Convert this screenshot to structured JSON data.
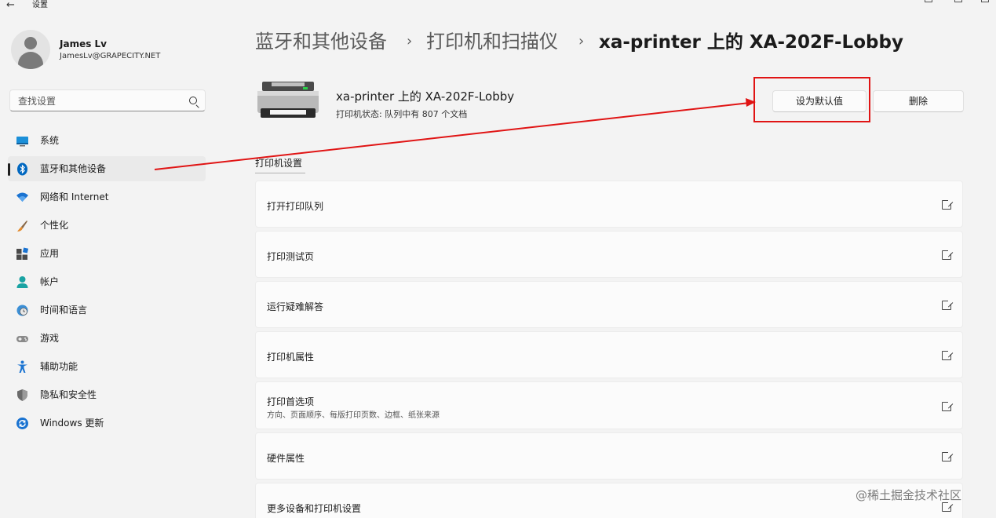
{
  "window": {
    "title": "设置"
  },
  "user": {
    "name": "James Lv",
    "email": "JamesLv@GRAPECITY.NET"
  },
  "search": {
    "placeholder": "查找设置"
  },
  "nav": [
    {
      "label": "系统",
      "icon": "monitor-icon"
    },
    {
      "label": "蓝牙和其他设备",
      "icon": "bluetooth-icon",
      "active": true
    },
    {
      "label": "网络和 Internet",
      "icon": "wifi-icon"
    },
    {
      "label": "个性化",
      "icon": "brush-icon"
    },
    {
      "label": "应用",
      "icon": "apps-icon"
    },
    {
      "label": "帐户",
      "icon": "account-icon"
    },
    {
      "label": "时间和语言",
      "icon": "globe-clock-icon"
    },
    {
      "label": "游戏",
      "icon": "gamepad-icon"
    },
    {
      "label": "辅助功能",
      "icon": "accessibility-icon"
    },
    {
      "label": "隐私和安全性",
      "icon": "shield-icon"
    },
    {
      "label": "Windows 更新",
      "icon": "update-icon"
    }
  ],
  "breadcrumb": {
    "level1": "蓝牙和其他设备",
    "level2": "打印机和扫描仪",
    "current": "xa-printer 上的 XA-202F-Lobby",
    "separator": "›"
  },
  "printer": {
    "name": "xa-printer 上的 XA-202F-Lobby",
    "status": "打印机状态:  队列中有 807 个文档"
  },
  "actions": {
    "set_default": "设为默认值",
    "remove": "删除"
  },
  "section": {
    "title": "打印机设置"
  },
  "settings": [
    {
      "label": "打开打印队列"
    },
    {
      "label": "打印测试页"
    },
    {
      "label": "运行疑难解答"
    },
    {
      "label": "打印机属性"
    },
    {
      "label": "打印首选项",
      "sub": "方向、页面顺序、每版打印页数、边框、纸张来源"
    },
    {
      "label": "硬件属性"
    },
    {
      "label": "更多设备和打印机设置"
    }
  ],
  "watermark": "@稀土掘金技术社区",
  "colors": {
    "annotation": "#e01414",
    "accent": "#0067c0"
  }
}
